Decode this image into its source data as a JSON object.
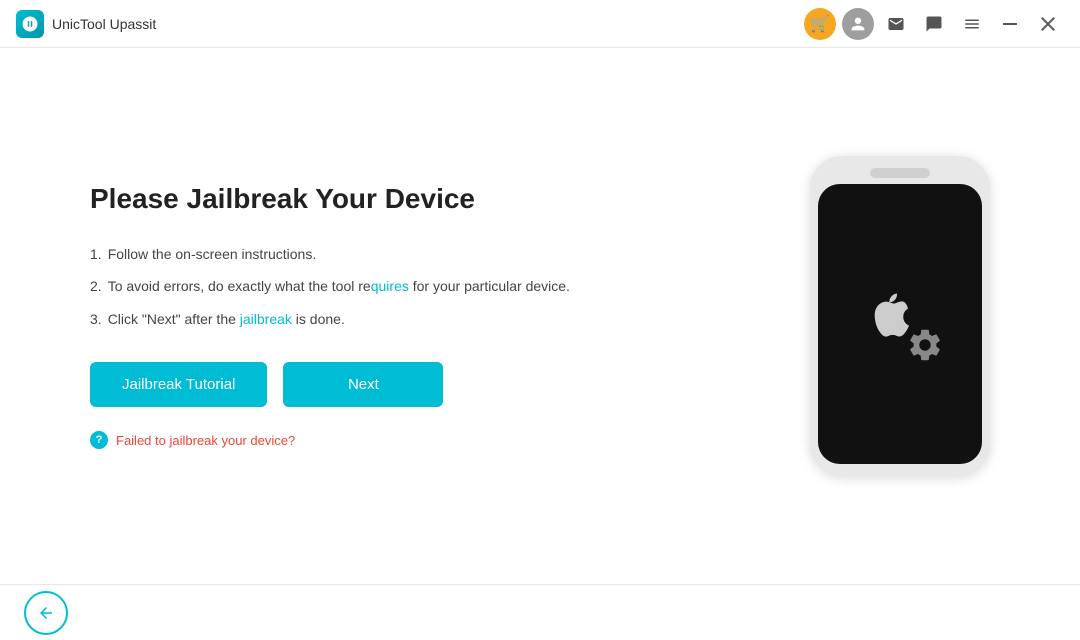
{
  "titleBar": {
    "appTitle": "UnicTool Upassit",
    "cartIcon": "🛒",
    "userIcon": "👤",
    "mailIcon": "✉",
    "chatIcon": "💬",
    "menuIcon": "☰",
    "minimizeIcon": "—",
    "closeIcon": "✕"
  },
  "main": {
    "pageTitle": "Please Jailbreak Your Device",
    "instructions": [
      {
        "number": "1.",
        "text": "Follow the on-screen instructions."
      },
      {
        "number": "2.",
        "text": "To avoid errors, do exactly what the tool requires for your particular device."
      },
      {
        "number": "3.",
        "text": "Click \"Next\" after the jailbreak is done."
      }
    ],
    "buttons": {
      "jailbreakTutorial": "Jailbreak Tutorial",
      "next": "Next"
    },
    "helpLink": "Failed to jailbreak your device?"
  },
  "footer": {
    "backLabel": "←"
  }
}
